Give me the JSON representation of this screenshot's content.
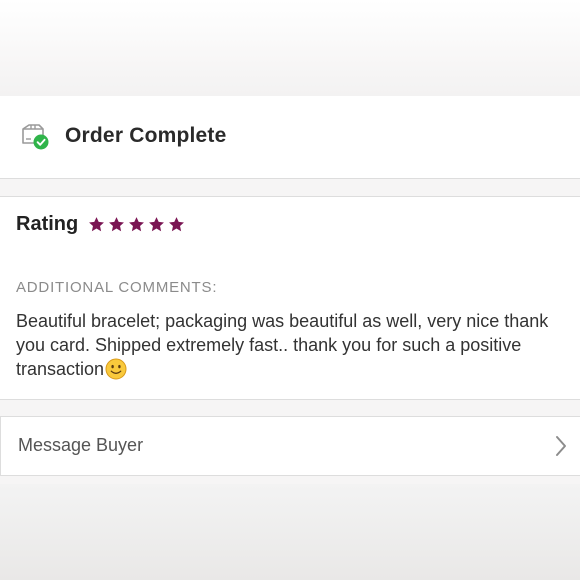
{
  "status": {
    "icon": "package-check-icon",
    "label": "Order Complete",
    "icon_check_color": "#2fb44a"
  },
  "rating": {
    "label": "Rating",
    "stars": 5,
    "max_stars": 5,
    "star_color": "#7a1553"
  },
  "comments": {
    "heading": "ADDITIONAL COMMENTS:",
    "text": "Beautiful bracelet; packaging was beautiful as well, very nice thank you card. Shipped extremely fast.. thank you for such a positive transaction",
    "emoji": "slightly-smiling-face"
  },
  "message_buyer": {
    "label": "Message Buyer",
    "icon": "chevron-right-icon"
  }
}
